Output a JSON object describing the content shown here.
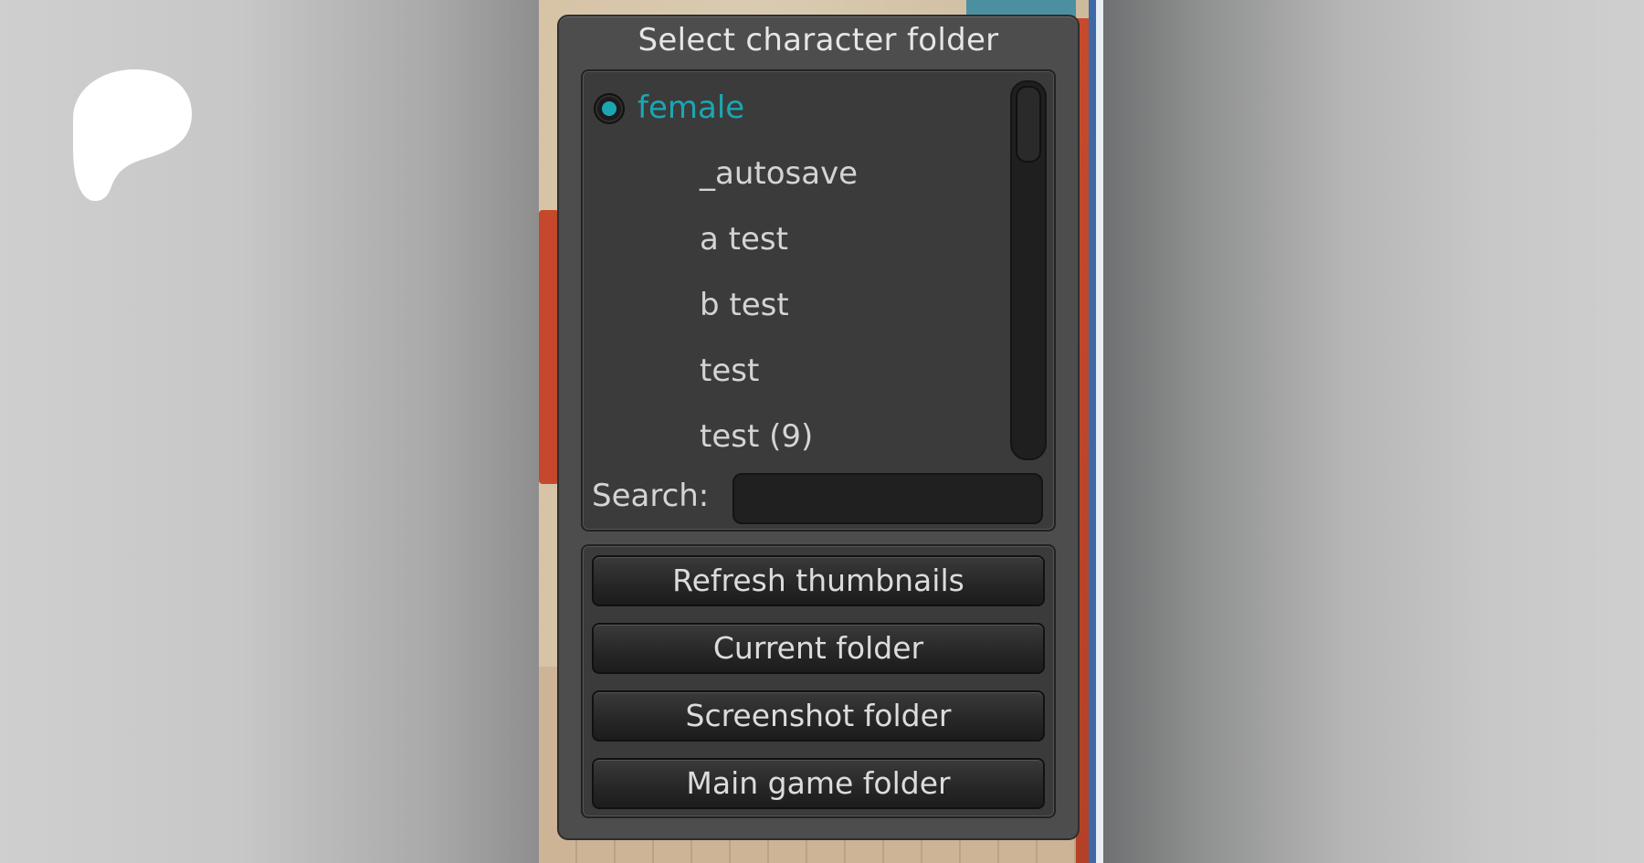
{
  "dialog": {
    "title": "Select character folder"
  },
  "folder_list": {
    "items": [
      {
        "label": "female",
        "selected": true
      },
      {
        "label": "_autosave",
        "selected": false
      },
      {
        "label": "a test",
        "selected": false
      },
      {
        "label": "b test",
        "selected": false
      },
      {
        "label": "test",
        "selected": false
      },
      {
        "label": "test (9)",
        "selected": false
      }
    ]
  },
  "search": {
    "label": "Search:",
    "value": ""
  },
  "buttons": {
    "refresh": "Refresh thumbnails",
    "current": "Current folder",
    "screenshot": "Screenshot folder",
    "main_game": "Main game folder"
  },
  "colors": {
    "accent": "#1aa7b3",
    "dialog_bg": "#4d4d4d",
    "panel_bg": "#3b3b3b"
  },
  "icons": {
    "logo": "patreon-logo-icon",
    "radio": "radio-selected-icon"
  }
}
